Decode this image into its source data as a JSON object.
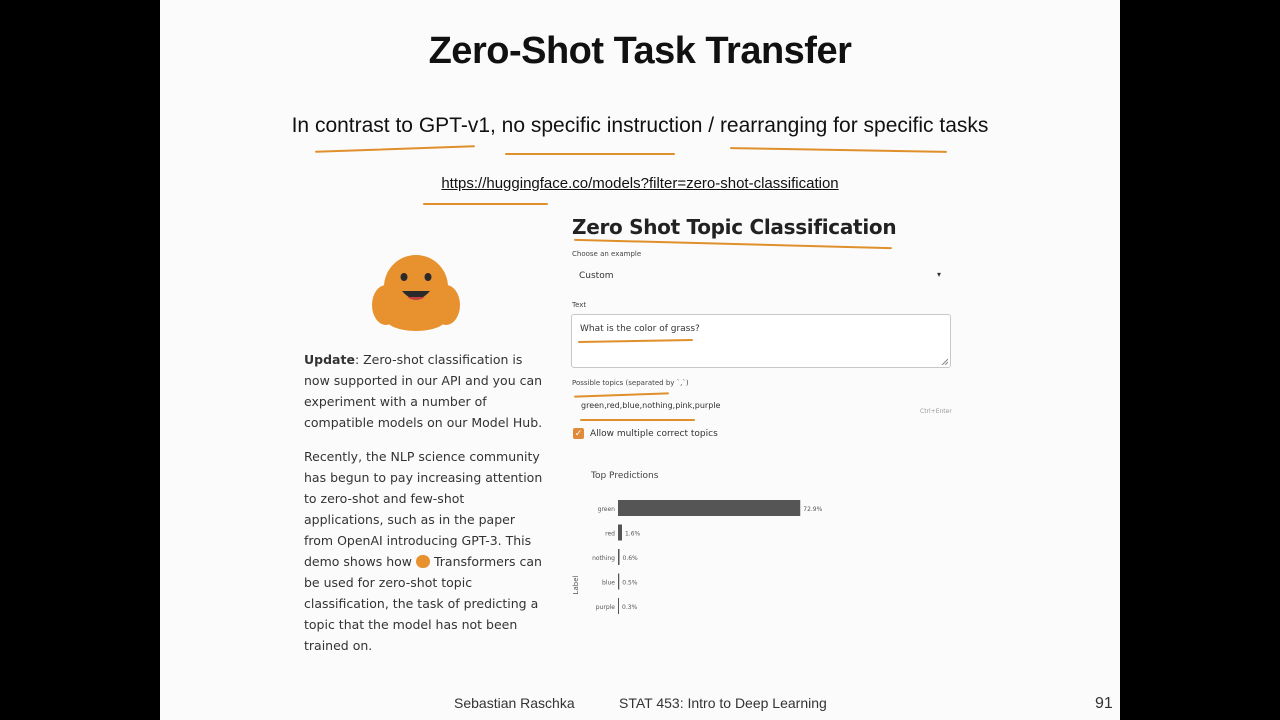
{
  "slide": {
    "title": "Zero-Shot Task Transfer",
    "subtitle": "In contrast to GPT-v1, no specific instruction / rearranging for specific tasks",
    "link": "https://huggingface.co/models?filter=zero-shot-classification",
    "footer_author": "Sebastian Raschka",
    "footer_course": "STAT 453: Intro to Deep Learning",
    "page_number": "91",
    "annotation_color": "#e0902a"
  },
  "demo": {
    "title": "Zero Shot Topic Classification",
    "choose_label": "Choose an example",
    "choose_value": "Custom",
    "text_label": "Text",
    "text_value": "What is the color of grass?",
    "topics_label": "Possible topics (separated by `,`)",
    "topics_value": "green,red,blue,nothing,pink,purple",
    "topics_hint": "Ctrl+Enter",
    "multi_label": "Allow multiple correct topics",
    "multi_checked": true,
    "predictions_title": "Top Predictions",
    "accent": "#e08a3a"
  },
  "description": {
    "update_bold": "Update",
    "update_rest": ": Zero-shot classification is now supported in our API and you can experiment with a number of compatible models on our Model Hub.",
    "para2_before": "Recently, the NLP science community has begun to pay increasing attention to zero-shot and few-shot applications, such as in the paper from OpenAI introducing GPT-3. This demo shows how",
    "para2_after": "Transformers can be used for zero-shot topic classification, the task of predicting a topic that the model has not been trained on."
  },
  "chart_data": {
    "type": "bar",
    "orientation": "horizontal",
    "categories": [
      "green",
      "red",
      "nothing",
      "blue",
      "purple"
    ],
    "values": [
      72.9,
      1.6,
      0.6,
      0.5,
      0.3
    ],
    "labels": [
      "72.9%",
      "1.6%",
      "0.6%",
      "0.5%",
      "0.3%"
    ],
    "ylabel": "Label",
    "bar_color": "#555555"
  }
}
